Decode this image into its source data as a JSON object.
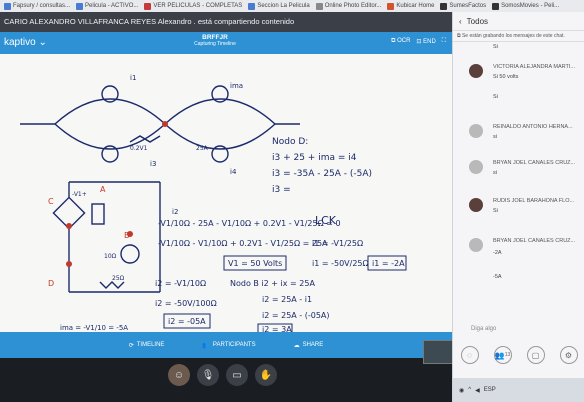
{
  "bookmarks": [
    {
      "label": "Fapsury / consultas..."
    },
    {
      "label": "Pelicula - ACTIVO..."
    },
    {
      "label": "VER PELICULAS - COMPLETAS"
    },
    {
      "label": "Seccion La Pelicula"
    },
    {
      "label": "Online Photo Editor..."
    },
    {
      "label": "Kubicar Home"
    },
    {
      "label": "SumesFactos"
    },
    {
      "label": "SomosMovies - Peli..."
    }
  ],
  "share_banner": "CARIO ALEXANDRO VILLAFRANCA REYES Alexandro . está compartiendo contenido",
  "presentation": {
    "brand": "kaptivo",
    "brief_title": "BRFFJR",
    "brief_subtitle": "Capturing Timeline",
    "header_controls": [
      "OCR",
      "END"
    ],
    "footer": {
      "timeline": "TIMELINE",
      "participants": "PARTICIPANTS",
      "share": "SHARE"
    },
    "board": {
      "nodo_title": "Nodo D:",
      "eq1": "i3 + 25 + ima = i4",
      "eq2": "i3 = -35A - 25A - (-5A)",
      "eq3": "i3 =",
      "lck": "LCK",
      "kcl1": "-V1/10Ω - 25A - V1/10Ω + 0.2V1 - V1/25Ω = 0",
      "kcl2": "-V1/10Ω - V1/10Ω + 0.2V1 - V1/25Ω = 25A",
      "v1box": "V1 = 50 Volts",
      "i1frac": "i1 = -V1/25Ω",
      "i1val": "i1 = -50V/25Ω",
      "i1box": "i1 = -2A",
      "i2frac": "i2 = -V1/10Ω",
      "i2val": "i2 = -50V/100Ω",
      "i2box": "i2 = -05A",
      "nodob": "Nodo B  i2 + ix = 25A",
      "ix1": "i2 = 25A - i1",
      "ix2": "i2 = 25A - (-05A)",
      "ix3": "i2 = 3A",
      "ima": "ima = -V1/10 = -5A",
      "labels": {
        "c": "C",
        "d": "D",
        "a": "A",
        "b": "B",
        "dep": "0.2V1",
        "src": "25A",
        "r10": "10Ω",
        "r25": "25Ω",
        "vl": "-V1+",
        "i1": "i1",
        "i2": "i2",
        "i3": "i3",
        "i4": "i4",
        "ima_l": "ima"
      }
    }
  },
  "chat": {
    "title": "Todos",
    "recording_note": "Se están grabando los mensajes de este chat.",
    "messages": [
      {
        "name": "",
        "text": "Si"
      },
      {
        "name": "VICTORIA ALEJANDRA MARTI...",
        "text": "Si 50 volts"
      },
      {
        "name": "",
        "text": "Si"
      },
      {
        "name": "REINALDO ANTONIO HERNA...",
        "text": "si"
      },
      {
        "name": "BRYAN JOEL CANALES CRUZ...",
        "text": "si"
      },
      {
        "name": "RUDIS JOEL BARAHONA FLO...",
        "text": "Si"
      },
      {
        "name": "BRYAN JOEL CANALES CRUZ...",
        "text": "-2A"
      },
      {
        "name": "",
        "text": "-5A"
      }
    ],
    "input_placeholder": "Diga algo",
    "participants_count": "13",
    "taskbar_lang": "ESP",
    "colors": {
      "accent": "#2d91d3"
    }
  }
}
